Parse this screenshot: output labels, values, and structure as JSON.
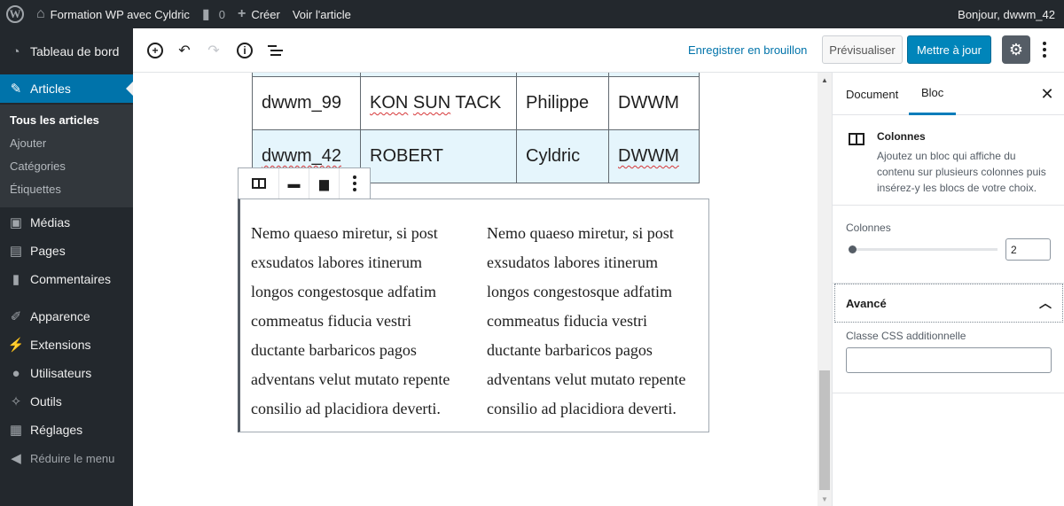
{
  "adminbar": {
    "site_name": "Formation WP avec Cyldric",
    "comments_count": "0",
    "new_label": "Créer",
    "view_post": "Voir l'article",
    "greeting": "Bonjour, dwwm_42"
  },
  "sidebar": {
    "dashboard": "Tableau de bord",
    "articles": "Articles",
    "submenu": [
      "Tous les articles",
      "Ajouter",
      "Catégories",
      "Étiquettes"
    ],
    "items": [
      "Médias",
      "Pages",
      "Commentaires",
      "Apparence",
      "Extensions",
      "Utilisateurs",
      "Outils",
      "Réglages"
    ],
    "collapse": "Réduire le menu"
  },
  "header": {
    "save_draft": "Enregistrer en brouillon",
    "preview": "Prévisualiser",
    "update": "Mettre à jour"
  },
  "table": {
    "rows": [
      [
        "dwwm_99",
        "KON SUN TACK",
        "Philippe",
        "DWWM"
      ],
      [
        "dwwm_42",
        "ROBERT",
        "Cyldric",
        "DWWM"
      ]
    ]
  },
  "columns": {
    "left": [
      "Nemo quaeso miretur, si post",
      "exsudatos labores itinerum",
      "longos congestosque adfatim",
      "commeatus fiducia vestri",
      "ductante barbaricos pagos",
      "adventans velut mutato repente",
      "consilio ad placidiora deverti."
    ],
    "right": [
      "Nemo quaeso miretur, si post",
      "exsudatos labores itinerum",
      "longos congestosque adfatim",
      "commeatus fiducia vestri",
      "ductante barbaricos pagos",
      "adventans velut mutato repente",
      "consilio ad placidiora deverti."
    ]
  },
  "inspector": {
    "tab_document": "Document",
    "tab_block": "Bloc",
    "block_title": "Colonnes",
    "block_desc": "Ajoutez un bloc qui affiche du contenu sur plusieurs colonnes puis insérez-y les blocs de votre choix.",
    "columns_label": "Colonnes",
    "columns_value": "2",
    "advanced": "Avancé",
    "css_label": "Classe CSS additionnelle"
  }
}
